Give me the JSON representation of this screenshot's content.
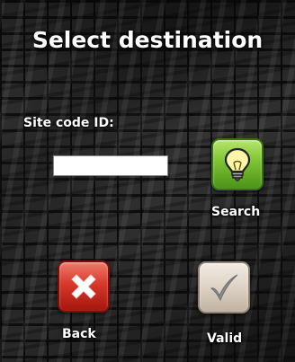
{
  "screen": {
    "title": "Select destination"
  },
  "form": {
    "site_code_label": "Site code ID:",
    "site_code_value": ""
  },
  "buttons": {
    "search": {
      "label": "Search",
      "icon": "lightbulb-icon",
      "color": "#7cc232"
    },
    "back": {
      "label": "Back",
      "icon": "close-x-icon",
      "color": "#d7382a"
    },
    "valid": {
      "label": "Valid",
      "icon": "checkmark-icon",
      "color": "#ddd2c4"
    }
  }
}
